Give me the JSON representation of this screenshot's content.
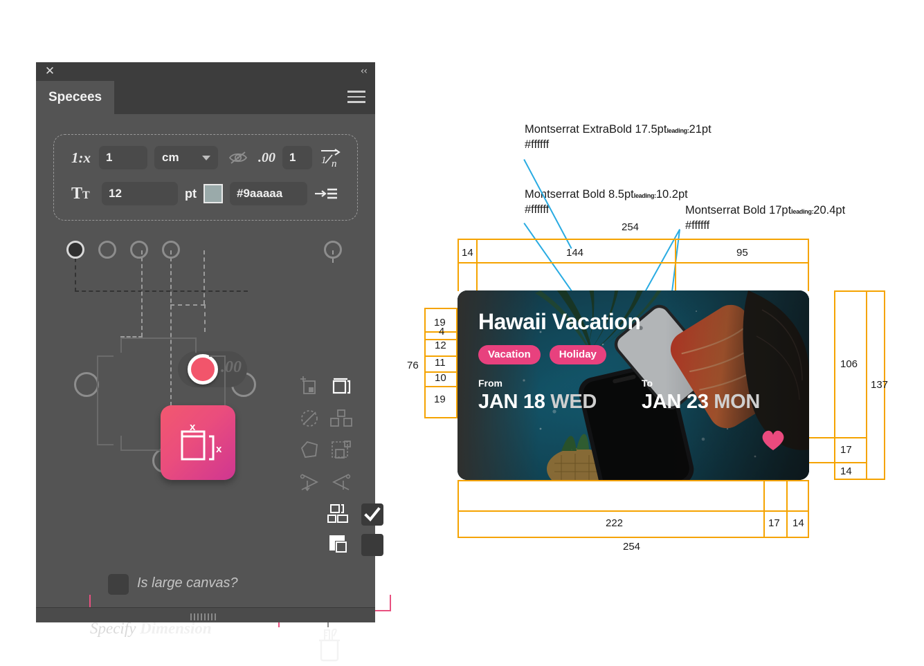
{
  "panel": {
    "tab_label": "Specees",
    "close_icon": "close-icon",
    "collapse_icon": "chevron-double-left-icon",
    "menu_icon": "hamburger-menu-icon",
    "fields": {
      "scale_label": "1:x",
      "scale_value": "1",
      "unit_value": "cm",
      "visibility_icon": "eye-off-icon",
      "decimal_label": ".00",
      "decimal_value": "1",
      "fraction_icon": "one-over-n-icon",
      "text_size_icon": "Tt",
      "text_size_value": "12",
      "text_size_unit": "pt",
      "color_swatch": "#9aaaaa",
      "color_hex": "#9aaaaa",
      "align_icon": "align-text-icon"
    },
    "checkbox_label": "Is large canvas?",
    "footer_title_light": "Specify",
    "footer_title_bold": "Dimension",
    "footer_icons": [
      "dimension-icon",
      "toolbox-icon"
    ],
    "tool_icons": [
      "add-artboard-icon",
      "duplicate-frame-icon",
      "rotate-dashed-icon",
      "distribute-objects-icon",
      "polygon-icon",
      "group-objects-icon",
      "angle-right-icon",
      "angle-left-icon",
      "arrange-objects-icon",
      "check-icon",
      "corner-shape-icon",
      "empty-swatch-icon"
    ]
  },
  "spec": {
    "annotations": [
      {
        "font": "Montserrat ExtraBold 17.5pt",
        "lead_label": "leading:",
        "leading": "21pt",
        "color": "#ffffff"
      },
      {
        "font": "Montserrat Bold 8.5pt",
        "lead_label": "leading:",
        "leading": "10.2pt",
        "color": "#ffffff"
      },
      {
        "font": "Montserrat Bold 17pt",
        "lead_label": "leading:",
        "leading": "20.4pt",
        "color": "#ffffff"
      }
    ],
    "measurements": {
      "top_total": "254",
      "top_segments": [
        "14",
        "144",
        "95"
      ],
      "left_total": "76",
      "left_segments": [
        "19",
        "4",
        "12",
        "11",
        "10",
        "19"
      ],
      "right_total": "137",
      "right_segments": [
        "106",
        "17",
        "14"
      ],
      "bottom_total": "254",
      "bottom_segments": [
        "222",
        "17",
        "14"
      ]
    },
    "ruler_color": "#F5A300",
    "leader_color": "#29ABE2"
  },
  "card": {
    "title": "Hawaii Vacation",
    "tags": [
      "Vacation",
      "Holiday"
    ],
    "from_label": "From",
    "from_date": "JAN 18",
    "from_day": "WED",
    "to_label": "To",
    "to_date": "JAN 23",
    "to_day": "MON",
    "favorite_icon": "heart-icon",
    "tag_color": "#e8417e",
    "heart_color": "#ea4a7e"
  }
}
